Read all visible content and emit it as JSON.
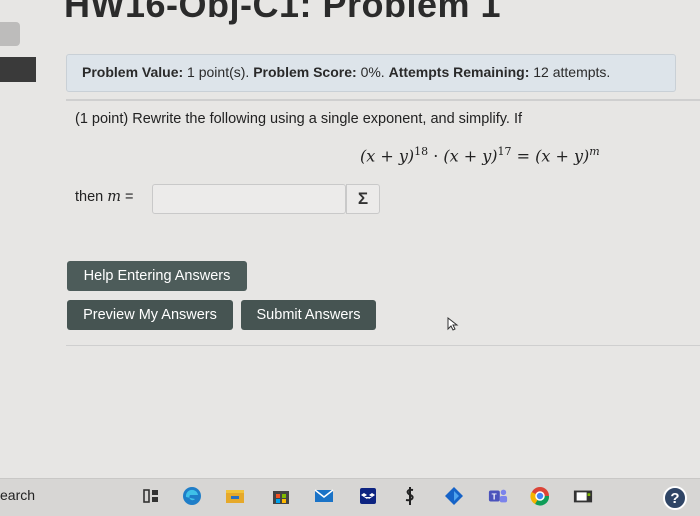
{
  "page": {
    "title": "HW16-Obj-C1: Problem 1"
  },
  "problem_info": {
    "value_label": "Problem Value:",
    "value": "1 point(s).",
    "score_label": "Problem Score:",
    "score": "0%.",
    "attempts_label": "Attempts Remaining:",
    "attempts": "12 attempts."
  },
  "problem": {
    "prompt": "(1 point) Rewrite the following using a single exponent, and simplify. If",
    "equation": {
      "base1": "(x + y)",
      "exp1": "18",
      "dot": "·",
      "base2": "(x + y)",
      "exp2": "17",
      "equals": "=",
      "base3": "(x + y)",
      "exp3": "m"
    },
    "answer_prefix": "then",
    "answer_var": "m",
    "answer_equals": "=",
    "answer_value": "",
    "sigma_label": "Σ"
  },
  "buttons": {
    "help": "Help Entering Answers",
    "preview": "Preview My Answers",
    "submit": "Submit Answers"
  },
  "taskbar": {
    "search_text": "earch",
    "help_label": "?"
  }
}
